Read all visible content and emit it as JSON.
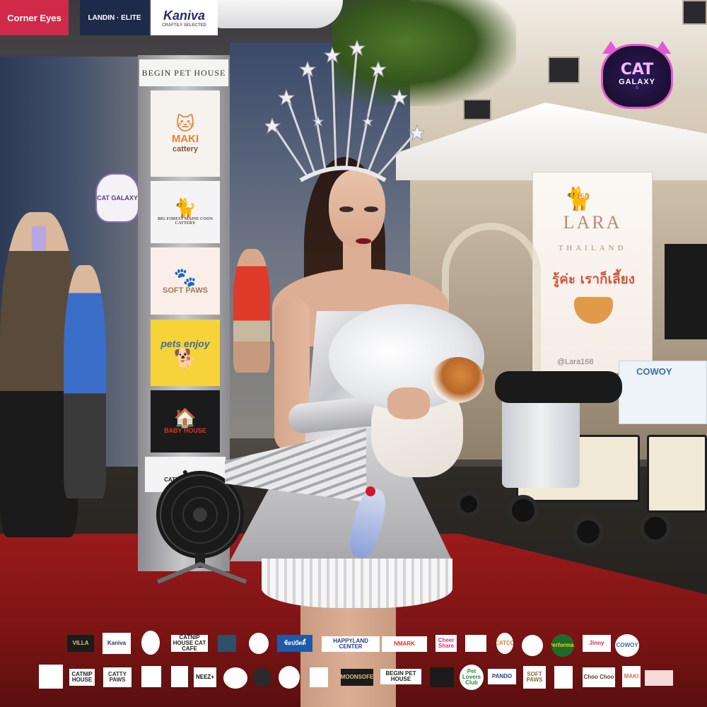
{
  "top_signs": {
    "left": "Corner Eyes",
    "middle": "LANDIN · ELITE",
    "right_brand": "Kaniva",
    "right_tagline": "CRAFTILY SELECTED"
  },
  "pillar": {
    "header": "BEGIN PET HOUSE",
    "cards": [
      {
        "name": "MAKI",
        "sub": "cattery",
        "icon": "cat-face-icon"
      },
      {
        "name": "BIG FOREST MAINE COON CATTERY",
        "icon": "maine-coon-icon"
      },
      {
        "name": "SOFT PAWS",
        "icon": "cat-paws-icon"
      },
      {
        "name": "pets enjoy",
        "icon": "pets-icon"
      },
      {
        "name": "BABY HOUSE",
        "icon": "house-icon"
      },
      {
        "name": "CATNIP HOUSE",
        "icon": "catnip-icon"
      }
    ]
  },
  "event_logo": {
    "line1": "CAT",
    "line2": "GALAXY",
    "line3": "5"
  },
  "small_galaxy_sign": "CAT GALAXY",
  "lara_banner": {
    "number": "168",
    "brand": "LARA",
    "country": "THAILAND",
    "thai_tagline": "รู้ค่ะ เราก็เลี้ยง",
    "handle": "@Lara168"
  },
  "cowoy": "COWOY",
  "sponsors_row1": [
    {
      "label": "VILLA",
      "bg": "#1b1b1b",
      "fg": "#e0c27a"
    },
    {
      "label": "Kaniva",
      "bg": "#ffffff",
      "fg": "#2b2b6e"
    },
    {
      "label": "",
      "bg": "#ffffff",
      "fg": "#c88a2e"
    },
    {
      "label": "CATNIP HOUSE CAT CAFE",
      "bg": "#ffffff",
      "fg": "#222222"
    },
    {
      "label": "",
      "bg": "#2f4f6a",
      "fg": "#ffffff"
    },
    {
      "label": "",
      "bg": "#ffffff",
      "fg": "#c3262f"
    },
    {
      "label": "ช้อปบัดดี้",
      "bg": "#1f5aa8",
      "fg": "#ffffff"
    },
    {
      "label": "HAPPYLAND CENTER",
      "bg": "#ffffff",
      "fg": "#1f3f8a"
    },
    {
      "label": "NMARK",
      "bg": "#ffffff",
      "fg": "#e0312b"
    },
    {
      "label": "Cheer Share",
      "bg": "#ffffff",
      "fg": "#d8307a"
    },
    {
      "label": "",
      "bg": "#ffffff",
      "fg": "#6b5a3a"
    },
    {
      "label": "CATCO",
      "bg": "#ffffff",
      "fg": "#e07a2a"
    },
    {
      "label": "",
      "bg": "#ffffff",
      "fg": "#444444"
    },
    {
      "label": "Performax",
      "bg": "#1e6a2a",
      "fg": "#ffd400"
    },
    {
      "label": "Jinny",
      "bg": "#ffffff",
      "fg": "#e0245a"
    },
    {
      "label": "COWOY",
      "bg": "#ffffff",
      "fg": "#3a6ea8"
    }
  ],
  "sponsors_row2": [
    {
      "label": "",
      "bg": "#ffffff",
      "fg": "#8a5a3a"
    },
    {
      "label": "CATNIP HOUSE",
      "bg": "#ffffff",
      "fg": "#222222"
    },
    {
      "label": "CATTY PAWS",
      "bg": "#ffffff",
      "fg": "#333333"
    },
    {
      "label": "",
      "bg": "#ffffff",
      "fg": "#e06a2a"
    },
    {
      "label": "",
      "bg": "#ffffff",
      "fg": "#9a2a6a"
    },
    {
      "label": "NEEZ+",
      "bg": "#ffffff",
      "fg": "#111111"
    },
    {
      "label": "",
      "bg": "#ffffff",
      "fg": "#444444"
    },
    {
      "label": "",
      "bg": "#2a2a2a",
      "fg": "#d8c08a"
    },
    {
      "label": "",
      "bg": "#ffffff",
      "fg": "#c03030"
    },
    {
      "label": "",
      "bg": "#ffffff",
      "fg": "#2a5aa8"
    },
    {
      "label": "MOONSOFE",
      "bg": "#1b1b1b",
      "fg": "#e0c27a"
    },
    {
      "label": "BEGIN PET HOUSE",
      "bg": "#ffffff",
      "fg": "#222222"
    },
    {
      "label": "",
      "bg": "#1b1b1b",
      "fg": "#ffffff"
    },
    {
      "label": "Pet Lovers Club",
      "bg": "#ffffff",
      "fg": "#2a8a3a"
    },
    {
      "label": "PANDO",
      "bg": "#ffffff",
      "fg": "#1f3f8a"
    },
    {
      "label": "SOFT PAWS",
      "bg": "#ffffff",
      "fg": "#8a6a3a"
    },
    {
      "label": "",
      "bg": "#ffffff",
      "fg": "#222222"
    },
    {
      "label": "Choo Choo",
      "bg": "#ffffff",
      "fg": "#5a3a2a"
    },
    {
      "label": "MAKI",
      "bg": "#ffffff",
      "fg": "#d0704a"
    },
    {
      "label": "",
      "bg": "#f6dcd8",
      "fg": "#a05a50"
    }
  ]
}
